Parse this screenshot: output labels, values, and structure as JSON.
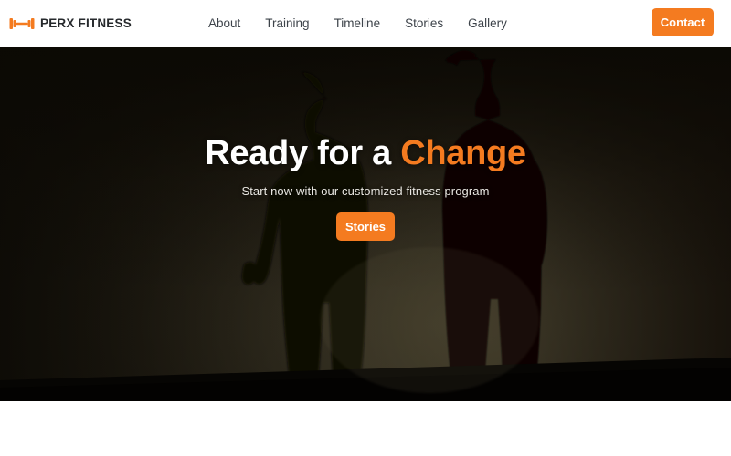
{
  "header": {
    "logo": {
      "icon": "dumbbell-icon",
      "text": "PERX FITNESS",
      "color": "#f47b20"
    },
    "nav_items": [
      {
        "label": "About"
      },
      {
        "label": "Training"
      },
      {
        "label": "Timeline"
      },
      {
        "label": "Stories"
      },
      {
        "label": "Gallery"
      }
    ],
    "contact_button": {
      "label": "Contact",
      "color": "#f47b20"
    },
    "background": "#ffffff",
    "nav_text_color": "#3d434a"
  },
  "hero": {
    "title_plain": "Ready for a",
    "title_accent": "Change",
    "subtitle": "Start now with our customized fitness program",
    "cta_label": "Stories",
    "accent_color": "#f47b20",
    "title_color": "#ffffff",
    "background_description": "Two muscular male silhouettes backlit against a warm dark olive-brown gradient",
    "background_colors": {
      "darkest": "#141109",
      "mid": "#332e20",
      "brightest": "#4c4736",
      "right_edge": "#1d1710"
    }
  },
  "below_fold": {
    "background": "#ffffff"
  }
}
